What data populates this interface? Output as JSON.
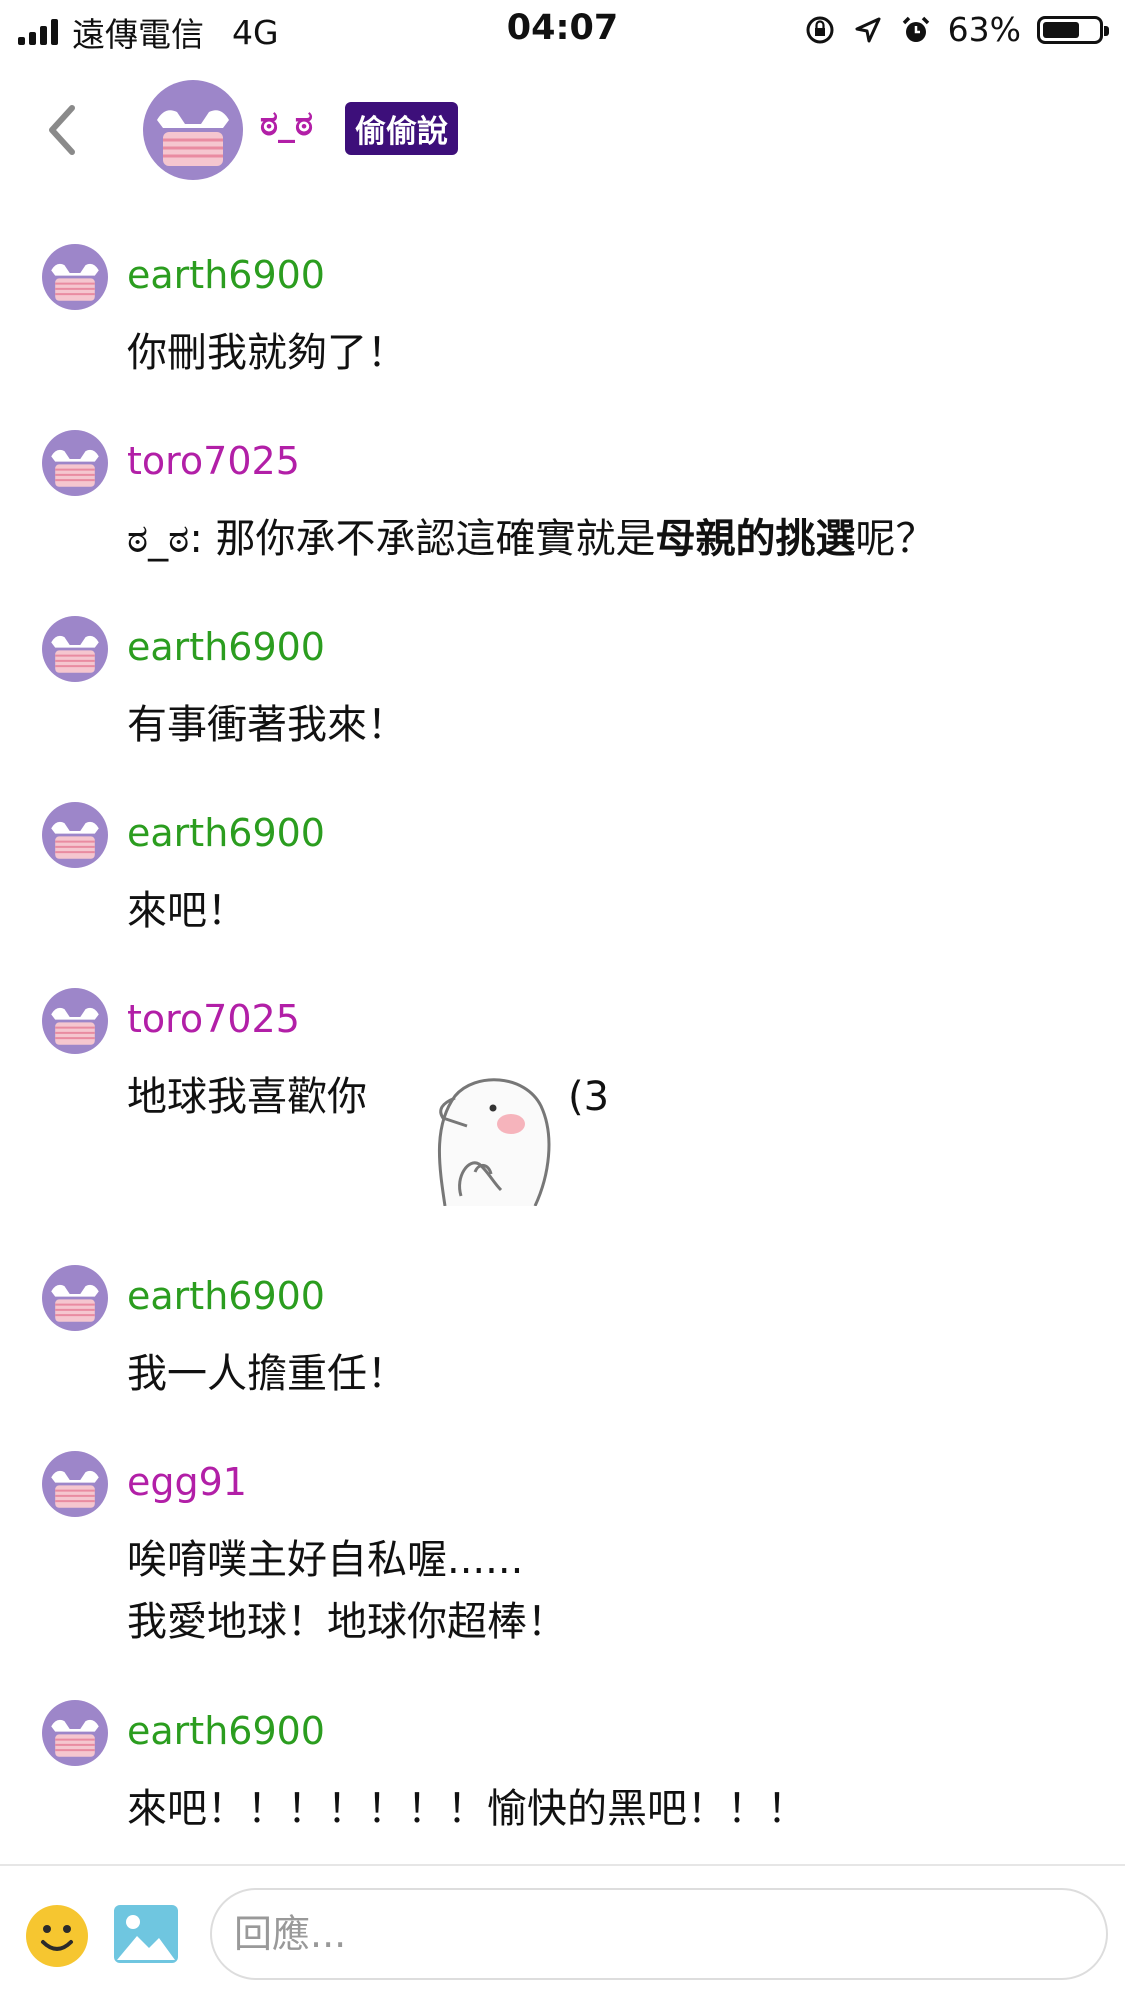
{
  "status_bar": {
    "carrier": "遠傳電信",
    "network": "4G",
    "time": "04:07",
    "battery": "63%",
    "battery_level": 0.63
  },
  "header": {
    "title_name": "ಠ_ಠ",
    "badge": "偷偷說"
  },
  "messages": [
    {
      "user": "earth6900",
      "color": "green",
      "text": "你刪我就夠了！"
    },
    {
      "user": "toro7025",
      "color": "purple",
      "text_prefix": "ಠ_ಠ: 那你承不承認這確實就是",
      "text_bold": "母親的挑選",
      "text_suffix": "呢？"
    },
    {
      "user": "earth6900",
      "color": "green",
      "text": "有事衝著我來！"
    },
    {
      "user": "earth6900",
      "color": "green",
      "text": "來吧！"
    },
    {
      "user": "toro7025",
      "color": "purple",
      "text": "地球我喜歡你",
      "after_sticker": "(3"
    },
    {
      "user": "earth6900",
      "color": "green",
      "text": "我一人擔重任！"
    },
    {
      "user": "egg91",
      "color": "purple",
      "text": "唉唷噗主好自私喔......\n我愛地球！地球你超棒！"
    },
    {
      "user": "earth6900",
      "color": "green",
      "text": "來吧！！！！！！！愉快的黑吧！！！"
    }
  ],
  "input": {
    "placeholder": "回應..."
  },
  "colors": {
    "green": "#2b9d1f",
    "purple": "#b21fa7",
    "badge_bg": "#3d0f7a"
  }
}
